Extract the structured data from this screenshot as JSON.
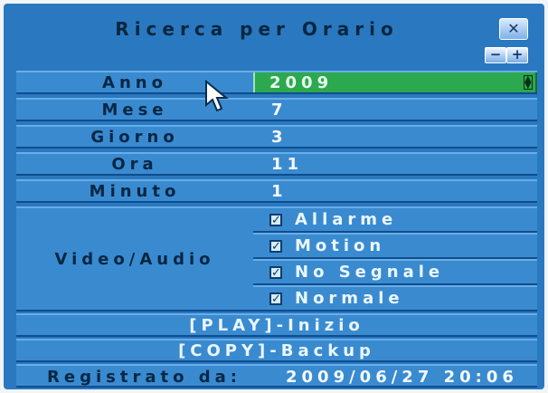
{
  "title": "Ricerca per Orario",
  "buttons": {
    "close": "✕",
    "minus": "−",
    "plus": "+"
  },
  "fields": [
    {
      "label": "Anno",
      "value": "2009",
      "selected": true
    },
    {
      "label": "Mese",
      "value": "7"
    },
    {
      "label": "Giorno",
      "value": "3"
    },
    {
      "label": "Ora",
      "value": "11"
    },
    {
      "label": "Minuto",
      "value": "1"
    }
  ],
  "video_audio": {
    "label": "Video/Audio",
    "options": [
      {
        "label": "Allarme",
        "checked": true
      },
      {
        "label": "Motion",
        "checked": true
      },
      {
        "label": "No Segnale",
        "checked": true
      },
      {
        "label": "Normale",
        "checked": true
      }
    ]
  },
  "actions": {
    "play": "[PLAY]-Inizio",
    "copy": "[COPY]-Backup"
  },
  "recorded": {
    "label": "Registrato da:",
    "value": "2009/06/27 20:06"
  },
  "icons": {
    "check": "checkmark-icon",
    "cursor": "mouse-pointer-icon",
    "stepper": "stepper-icon"
  },
  "colors": {
    "panel": "#2a78c0",
    "row": "#3a8ad0",
    "selected": "#2ca94f"
  }
}
